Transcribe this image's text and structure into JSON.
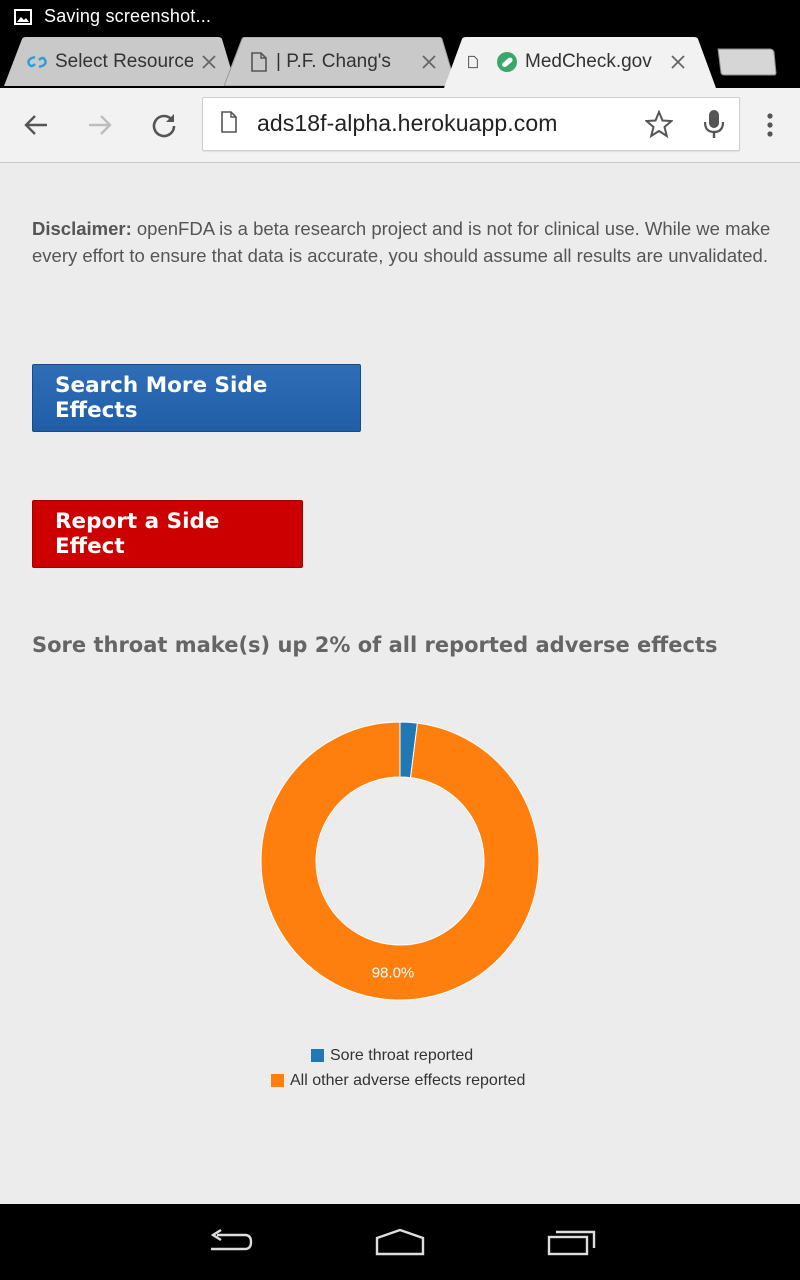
{
  "status_bar": {
    "notification_icon": "image-icon",
    "notification_text": "Saving screenshot..."
  },
  "tabs": [
    {
      "title": "Select Resource",
      "favicon": "link-icon",
      "active": false
    },
    {
      "title": "| P.F. Chang's",
      "favicon": "page-icon",
      "active": false
    },
    {
      "title": "MedCheck.gov",
      "favicon": "medcheck-icon",
      "active": true
    }
  ],
  "toolbar": {
    "url": "ads18f-alpha.herokuapp.com"
  },
  "content": {
    "disclaimer_label": "Disclaimer:",
    "disclaimer_text": " openFDA is a beta research project and is not for clinical use. While we make every effort to ensure that data is accurate, you should assume all results are unvalidated.",
    "search_button": "Search More Side Effects",
    "report_button": "Report a Side Effect",
    "headline": "Sore throat make(s) up 2% of all reported adverse effects"
  },
  "colors": {
    "blue_button": "#2464ad",
    "red_button": "#cc0000",
    "series_sore_throat": "#1f77b4",
    "series_other": "#ff7f0e"
  },
  "chart_data": {
    "type": "pie",
    "donut": true,
    "categories": [
      "Sore throat reported",
      "All other adverse effects reported"
    ],
    "values": [
      2.0,
      98.0
    ],
    "data_labels": [
      "",
      "98.0%"
    ],
    "legend_position": "bottom-center"
  }
}
